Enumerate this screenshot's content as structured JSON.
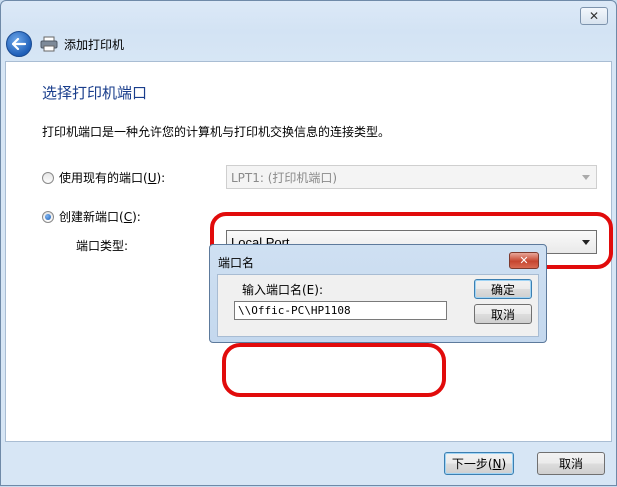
{
  "window": {
    "close_glyph": "✕"
  },
  "nav": {
    "title": "添加打印机"
  },
  "main": {
    "heading": "选择打印机端口",
    "description": "打印机端口是一种允许您的计算机与打印机交换信息的连接类型。",
    "existing_port": {
      "label_prefix": "使用现有的端口(",
      "accel": "U",
      "label_suffix": "):",
      "selected": false,
      "value": "LPT1: (打印机端口)"
    },
    "new_port": {
      "label_prefix": "创建新端口(",
      "accel": "C",
      "label_suffix": "):",
      "selected": true
    },
    "port_type": {
      "label": "端口类型:",
      "value": "Local Port"
    }
  },
  "dialog": {
    "title": "端口名",
    "close_glyph": "✕",
    "field_label": "输入端口名(E):",
    "field_value": "\\\\Offic-PC\\HP1108",
    "ok_label": "确定",
    "cancel_label": "取消"
  },
  "footer": {
    "next_prefix": "下一步(",
    "next_accel": "N",
    "next_suffix": ")",
    "cancel_label": "取消"
  },
  "colors": {
    "heading": "#1a3e8c",
    "highlight": "#e10b0b"
  }
}
